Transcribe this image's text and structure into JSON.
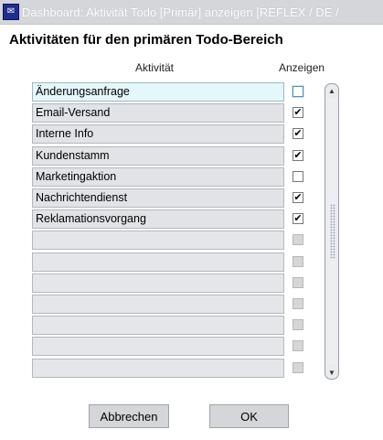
{
  "window": {
    "title": "Dashboard: Aktivität Todo [Primär] anzeigen   [REFLEX / DE / "
  },
  "dialog": {
    "heading": "Aktivitäten für den primären Todo-Bereich",
    "columns": {
      "activity": "Aktivität",
      "show": "Anzeigen"
    }
  },
  "rows": [
    {
      "label": "Änderungsanfrage",
      "checked": false,
      "enabled": true,
      "focused": true
    },
    {
      "label": "Email-Versand",
      "checked": true,
      "enabled": true
    },
    {
      "label": "Interne Info",
      "checked": true,
      "enabled": true
    },
    {
      "label": "Kundenstamm",
      "checked": true,
      "enabled": true
    },
    {
      "label": "Marketingaktion",
      "checked": false,
      "enabled": true
    },
    {
      "label": "Nachrichtendienst",
      "checked": true,
      "enabled": true
    },
    {
      "label": "Reklamationsvorgang",
      "checked": true,
      "enabled": true
    },
    {
      "label": "",
      "checked": false,
      "enabled": false
    },
    {
      "label": "",
      "checked": false,
      "enabled": false
    },
    {
      "label": "",
      "checked": false,
      "enabled": false
    },
    {
      "label": "",
      "checked": false,
      "enabled": false
    },
    {
      "label": "",
      "checked": false,
      "enabled": false
    },
    {
      "label": "",
      "checked": false,
      "enabled": false
    },
    {
      "label": "",
      "checked": false,
      "enabled": false
    }
  ],
  "buttons": {
    "cancel": "Abbrechen",
    "ok": "OK"
  },
  "icons": {
    "app": "app-icon",
    "check": "checkmark-icon",
    "scroll_up": "scroll-up-icon",
    "scroll_down": "scroll-down-icon"
  }
}
